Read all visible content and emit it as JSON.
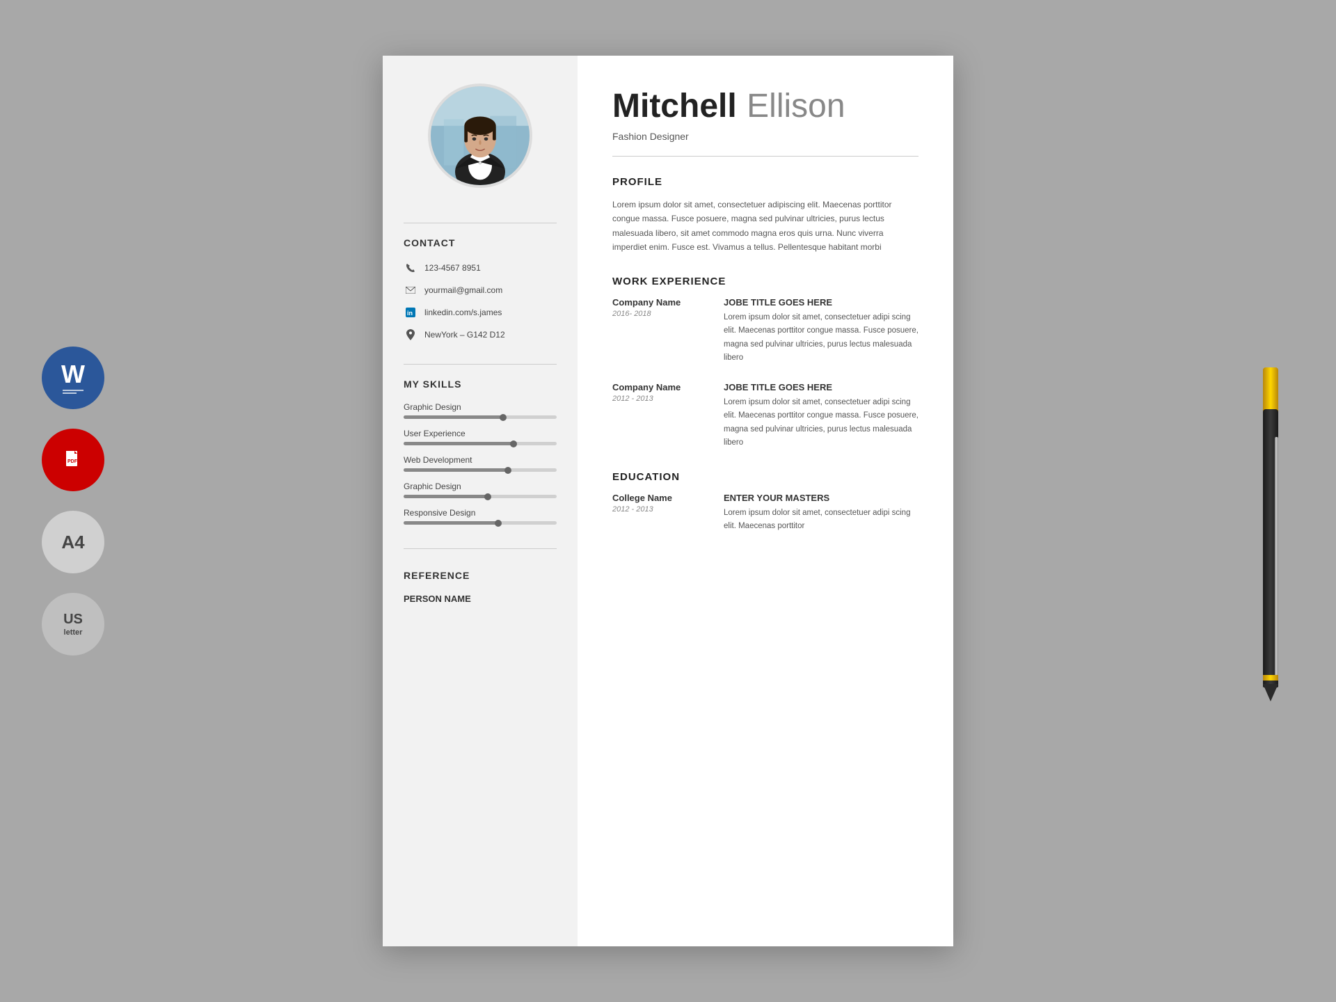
{
  "page": {
    "background_color": "#a8a8a8"
  },
  "side_icons": {
    "word_label": "W",
    "pdf_label": "PDF",
    "a4_label": "A4",
    "us_label": "US",
    "us_sublabel": "letter"
  },
  "resume": {
    "first_name": "Mitchell",
    "last_name": "Ellison",
    "job_title": "Fashion Designer",
    "contact": {
      "section_title": "CONTACT",
      "phone": "123-4567 8951",
      "email": "yourmail@gmail.com",
      "linkedin": "linkedin.com/s.james",
      "location": "NewYork – G142 D12"
    },
    "skills": {
      "section_title": "MY SKILLS",
      "items": [
        {
          "name": "Graphic Design",
          "percent": 65
        },
        {
          "name": "User Experience",
          "percent": 72
        },
        {
          "name": "Web Development",
          "percent": 68
        },
        {
          "name": "Graphic Design",
          "percent": 55
        },
        {
          "name": "Responsive Design",
          "percent": 62
        }
      ]
    },
    "reference": {
      "section_title": "REFERENCE",
      "person_label": "PERSON NAME"
    },
    "profile": {
      "section_title": "PROFILE",
      "text": "Lorem ipsum dolor sit amet, consectetuer adipiscing elit. Maecenas porttitor congue massa. Fusce posuere, magna sed pulvinar ultricies, purus lectus malesuada libero, sit amet commodo magna eros quis urna. Nunc viverra imperdiet enim. Fusce est. Vivamus a tellus. Pellentesque habitant morbi"
    },
    "work_experience": {
      "section_title": "WORK EXPERIENCE",
      "entries": [
        {
          "company": "Company Name",
          "dates": "2016- 2018",
          "job_title": "JOBE TITLE GOES HERE",
          "description": "Lorem ipsum dolor sit amet, consectetuer adipi scing elit. Maecenas porttitor congue massa. Fusce posuere, magna sed pulvinar ultricies, purus lectus malesuada libero"
        },
        {
          "company": "Company Name",
          "dates": "2012 - 2013",
          "job_title": "JOBE TITLE GOES HERE",
          "description": "Lorem ipsum dolor sit amet, consectetuer adipi scing elit. Maecenas porttitor congue massa. Fusce posuere, magna sed pulvinar ultricies, purus lectus malesuada libero"
        }
      ]
    },
    "education": {
      "section_title": "EDUCATION",
      "entries": [
        {
          "college": "College Name",
          "dates": "2012 - 2013",
          "degree": "ENTER YOUR MASTERS",
          "description": "Lorem ipsum dolor sit amet, consectetuer adipi scing elit. Maecenas porttitor"
        }
      ]
    }
  }
}
